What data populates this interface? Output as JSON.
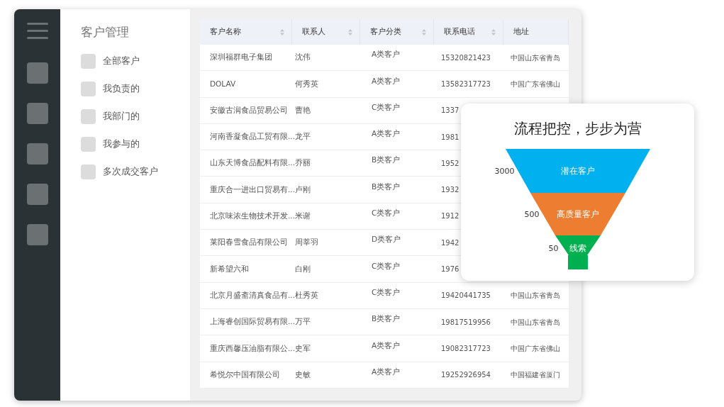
{
  "filter_panel": {
    "title": "客户管理",
    "options": [
      {
        "label": "全部客户",
        "checked": false
      },
      {
        "label": "我负责的",
        "checked": false
      },
      {
        "label": "我部门的",
        "checked": false
      },
      {
        "label": "我参与的",
        "checked": false
      },
      {
        "label": "多次成交客户",
        "checked": false
      }
    ]
  },
  "table": {
    "columns": [
      {
        "label": "客户名称",
        "sortable": true
      },
      {
        "label": "联系人",
        "sortable": true
      },
      {
        "label": "客户分类",
        "sortable": true
      },
      {
        "label": "联系电话",
        "sortable": true
      },
      {
        "label": "地址",
        "sortable": false
      }
    ],
    "rows": [
      {
        "name": "深圳福群电子集团",
        "contact": "沈伟",
        "category": "A类客户",
        "phone": "15320821423",
        "address": "中国山东省青岛"
      },
      {
        "name": "DOLAV",
        "contact": "何秀英",
        "category": "A类客户",
        "phone": "13582317723",
        "address": "中国广东省佛山"
      },
      {
        "name": "安徽古润食品贸易公司",
        "contact": "曹艳",
        "category": "C类客户",
        "phone": "1337"
      },
      {
        "name": "河南香凝食品工贸有限...",
        "contact": "龙平",
        "category": "A类客户",
        "phone": "1981"
      },
      {
        "name": "山东天博食品配料有限...",
        "contact": "乔丽",
        "category": "B类客户",
        "phone": "1952"
      },
      {
        "name": "重庆合一进出口贸易有...",
        "contact": "卢刚",
        "category": "B类客户",
        "phone": "1932"
      },
      {
        "name": "北京味浓生物技术开发...",
        "contact": "米谢",
        "category": "C类客户",
        "phone": "1912"
      },
      {
        "name": "莱阳春雪食品有限公司",
        "contact": "周莘羽",
        "category": "D类客户",
        "phone": "1942"
      },
      {
        "name": "新希望六和",
        "contact": "白刚",
        "category": "C类客户",
        "phone": "1976"
      },
      {
        "name": "北京月盛斋清真食品有...",
        "contact": "杜秀英",
        "category": "C类客户",
        "phone": "19420441735",
        "address": "中国山东省青岛"
      },
      {
        "name": "上海睿创国际贸易有限...",
        "contact": "万平",
        "category": "B类客户",
        "phone": "19817519956",
        "address": "中国山东省青岛"
      },
      {
        "name": "重庆西馨压油脂有限公...",
        "contact": "史军",
        "category": "A类客户",
        "phone": "19082317723",
        "address": "中国广东省佛山"
      },
      {
        "name": "希悦尔中国有限公司",
        "contact": "史敏",
        "category": "A类客户",
        "phone": "19252926954",
        "address": "中国福建省厦门"
      }
    ]
  },
  "funnel_card": {
    "title": "流程把控，步步为营",
    "stages": [
      {
        "label": "潜在客户",
        "value": "3000",
        "color": "#00b0ef"
      },
      {
        "label": "高质量客户",
        "value": "500",
        "color": "#ed7d31"
      },
      {
        "label": "线索",
        "value": "50",
        "color": "#00b050"
      }
    ]
  }
}
